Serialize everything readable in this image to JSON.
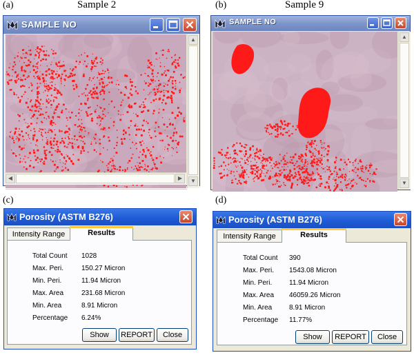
{
  "panel_labels": {
    "a": "(a)",
    "b": "(b)",
    "c": "(c)",
    "d": "(d)"
  },
  "captions": {
    "a": "Sample 2",
    "b": "Sample 9"
  },
  "image_windows": [
    {
      "title": "SAMPLE NO"
    },
    {
      "title": "SAMPLE NO"
    }
  ],
  "dialogs": [
    {
      "title": "Porosity (ASTM B276)",
      "tabs": [
        "Intensity Range",
        "Results"
      ],
      "active_tab": "Results",
      "rows": [
        {
          "label": "Total Count",
          "value": "1028"
        },
        {
          "label": "Max. Peri.",
          "value": "150.27 Micron"
        },
        {
          "label": "Min. Peri.",
          "value": "11.94 Micron"
        },
        {
          "label": "Max. Area",
          "value": "231.68 Micron"
        },
        {
          "label": "Min. Area",
          "value": "8.91 Micron"
        },
        {
          "label": "Percentage",
          "value": "6.24%"
        }
      ],
      "buttons": [
        "Show",
        "REPORT",
        "Close"
      ]
    },
    {
      "title": "Porosity (ASTM B276)",
      "tabs": [
        "Intensity Range",
        "Results"
      ],
      "active_tab": "Results",
      "rows": [
        {
          "label": "Total Count",
          "value": "390"
        },
        {
          "label": "Max. Peri.",
          "value": "1543.08 Micron"
        },
        {
          "label": "Min. Peri.",
          "value": "11.94 Micron"
        },
        {
          "label": "Max. Area",
          "value": "46059.26 Micron"
        },
        {
          "label": "Min. Area",
          "value": "8.91 Micron"
        },
        {
          "label": "Percentage",
          "value": "11.77%"
        }
      ],
      "buttons": [
        "Show",
        "REPORT",
        "Close"
      ]
    }
  ],
  "icons": [
    "app-logo-icon",
    "minimize-icon",
    "maximize-icon",
    "close-icon",
    "scroll-up-icon",
    "scroll-down-icon",
    "scroll-left-icon",
    "scroll-right-icon",
    "porosity-app-icon"
  ],
  "colors": {
    "pore_highlight": "#ff1a1a",
    "image_background": "#c9a9bd",
    "xp_title_blue": "#1f5bd6",
    "tab_accent": "#ffc83c"
  }
}
